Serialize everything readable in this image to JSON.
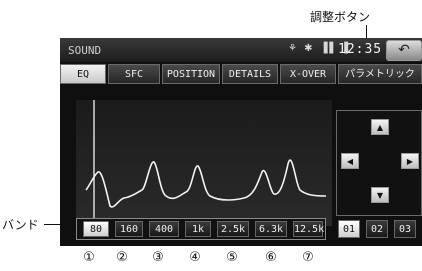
{
  "annotations": {
    "adjust_buttons": "調整ボタン",
    "bands": "バンド"
  },
  "statusbar": {
    "title": "SOUND",
    "icons": "⚘ ✱ ▐▌ ▌",
    "clock": "12:35",
    "back_icon": "↶"
  },
  "tabs": [
    {
      "label": "EQ",
      "active": true
    },
    {
      "label": "SFC",
      "active": false
    },
    {
      "label": "POSITION",
      "active": false
    },
    {
      "label": "DETAILS",
      "active": false
    },
    {
      "label": "X-OVER",
      "active": false
    },
    {
      "label": "パラメトリック",
      "active": false
    }
  ],
  "arrows": {
    "up": "▲",
    "down": "▼",
    "left": "◀",
    "right": "▶"
  },
  "bands": [
    "80",
    "160",
    "400",
    "1k",
    "2.5k",
    "6.3k",
    "12.5k"
  ],
  "active_band": "80",
  "presets": [
    {
      "label": "01",
      "active": true
    },
    {
      "label": "02",
      "active": false
    },
    {
      "label": "03",
      "active": false
    }
  ],
  "band_numbers": [
    "①",
    "②",
    "③",
    "④",
    "⑤",
    "⑥",
    "⑦"
  ]
}
